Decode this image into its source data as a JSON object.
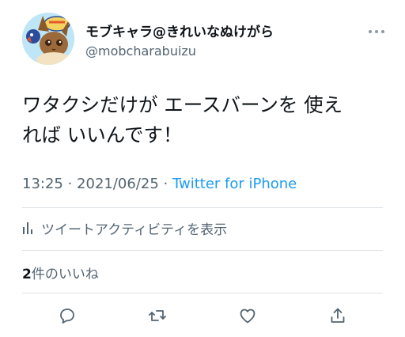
{
  "tweet": {
    "display_name": "モブキャラ@きれいなぬけがら",
    "handle": "@mobcharabuizu",
    "text_line1": "ワタクシだけが エースバーンを 使え",
    "text_line2": "れば いいんです！",
    "time": "13:25",
    "separator1": " · ",
    "date": "2021/06/25",
    "separator2": " · ",
    "source": "Twitter for iPhone",
    "analytics_label": "ツイートアクティビティを表示",
    "likes_count": "2",
    "likes_label": "件のいいね"
  },
  "actions": {
    "reply": "reply-icon",
    "retweet": "retweet-icon",
    "like": "heart-icon",
    "share": "share-icon"
  },
  "colors": {
    "accent": "#1d9bf0",
    "secondary_text": "#536471",
    "divider": "#dfe3e6"
  }
}
